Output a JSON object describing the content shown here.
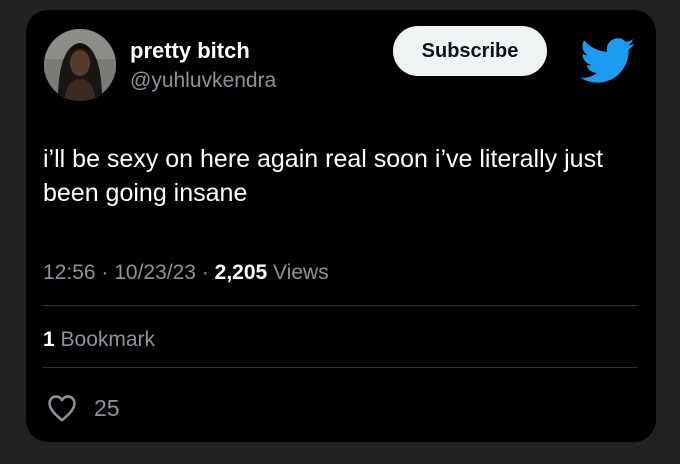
{
  "user": {
    "display_name": "pretty bitch",
    "handle": "@yuhluvkendra"
  },
  "subscribe_label": "Subscribe",
  "tweet": {
    "text": "i’ll be sexy on here again real soon i’ve literally just been going insane"
  },
  "meta": {
    "time": "12:56",
    "sep1": " · ",
    "date": "10/23/23",
    "sep2": " · ",
    "views_count": "2,205",
    "views_label": " Views"
  },
  "bookmarks": {
    "count": "1",
    "label": " Bookmark"
  },
  "likes": {
    "count": "25"
  },
  "colors": {
    "background": "#000000",
    "text": "#ffffff",
    "muted": "#8b949c",
    "twitter_blue": "#1d9bf0",
    "button_bg": "#eff3f4"
  },
  "icons": [
    "avatar-photo",
    "twitter-bird-icon",
    "heart-icon"
  ]
}
